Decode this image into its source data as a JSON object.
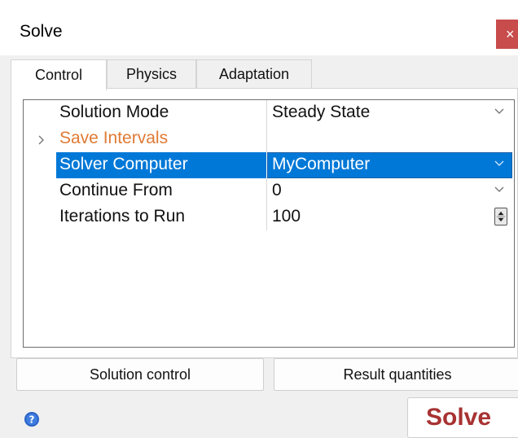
{
  "window": {
    "title": "Solve",
    "close_label": "×"
  },
  "tabs": [
    {
      "label": "Control",
      "active": true
    },
    {
      "label": "Physics",
      "active": false
    },
    {
      "label": "Adaptation",
      "active": false
    }
  ],
  "properties": [
    {
      "label": "Solution Mode",
      "value": "Steady State",
      "control": "dropdown"
    },
    {
      "label": "Save Intervals",
      "value": "",
      "control": "expander"
    },
    {
      "label": "Solver Computer",
      "value": "MyComputer",
      "control": "dropdown",
      "selected": true
    },
    {
      "label": "Continue From",
      "value": "0",
      "control": "dropdown"
    },
    {
      "label": "Iterations to Run",
      "value": "100",
      "control": "spinner"
    }
  ],
  "buttons": {
    "solution_control": "Solution control",
    "result_quantities": "Result quantities",
    "solve": "Solve"
  },
  "colors": {
    "selection": "#0078d7",
    "save_intervals_label": "#e07a34",
    "solve_text": "#a83232",
    "close_button": "#c84c4c"
  },
  "icons": {
    "expander": "chevron-right-icon",
    "dropdown": "chevron-down-icon",
    "spinner": "spinner-up-down-icon",
    "help": "help-icon",
    "close": "close-icon"
  }
}
